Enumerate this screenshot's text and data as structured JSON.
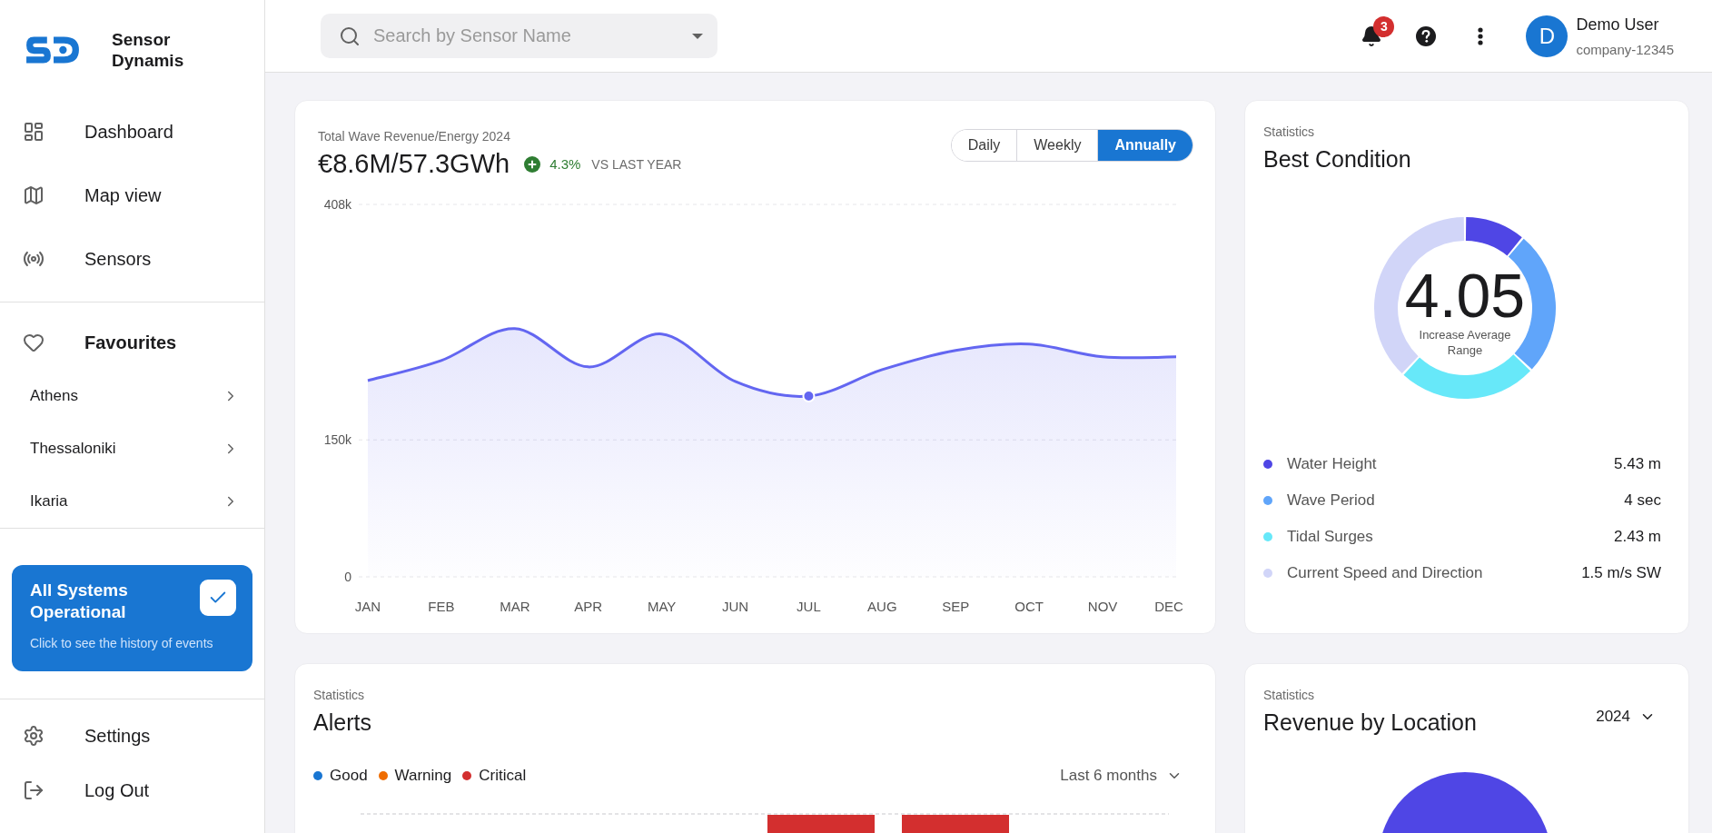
{
  "brand": {
    "name": "Sensor Dynamis"
  },
  "nav": [
    {
      "label": "Dashboard"
    },
    {
      "label": "Map view"
    },
    {
      "label": "Sensors"
    }
  ],
  "favourites": {
    "label": "Favourites",
    "items": [
      {
        "label": "Athens"
      },
      {
        "label": "Thessaloniki"
      },
      {
        "label": "Ikaria"
      }
    ]
  },
  "status_card": {
    "title": "All Systems Operational",
    "text": "Click to see the history of events",
    "checked": true
  },
  "footer_nav": [
    {
      "label": "Settings"
    },
    {
      "label": "Log Out"
    }
  ],
  "header": {
    "search": {
      "placeholder": "Search by Sensor Name"
    },
    "notifications": {
      "count": "3"
    },
    "user": {
      "initial": "D",
      "name": "Demo User",
      "company": "company-12345"
    }
  },
  "revenue_card": {
    "label": "Total Wave Revenue/Energy 2024",
    "value": "€8.6M/57.3GWh",
    "change": "4.3%",
    "change_caption": "VS LAST YEAR",
    "periods": [
      {
        "label": "Daily",
        "selected": false
      },
      {
        "label": "Weekly",
        "selected": false
      },
      {
        "label": "Annually",
        "selected": true
      }
    ],
    "chart_data": {
      "type": "area",
      "categories": [
        "JAN",
        "FEB",
        "MAR",
        "APR",
        "MAY",
        "JUN",
        "JUL",
        "AUG",
        "SEP",
        "OCT",
        "NOV",
        "DEC"
      ],
      "series": [
        {
          "color": "#6366f1",
          "values": [
            215000,
            237000,
            272000,
            230000,
            266000,
            214000,
            198000,
            227000,
            248000,
            255000,
            241000,
            241000
          ]
        }
      ],
      "ylim": [
        0,
        408000
      ],
      "yticks": [
        {
          "value": 0,
          "label": "0"
        },
        {
          "value": 150000,
          "label": "150k"
        },
        {
          "value": 408000,
          "label": "408k"
        }
      ],
      "annotations": [
        {
          "x": "JUL"
        }
      ]
    }
  },
  "best_condition": {
    "label": "Statistics",
    "title": "Best Condition",
    "value": "4.05",
    "caption": "Increase Average Range",
    "items": [
      {
        "name": "Water Height",
        "value": "5.43 m",
        "color": "#4f46e5"
      },
      {
        "name": "Wave Period",
        "value": "4 sec",
        "color": "#60a5fa"
      },
      {
        "name": "Tidal Surges",
        "value": "2.43 m",
        "color": "#67e8f9"
      },
      {
        "name": "Current Speed and Direction",
        "value": "1.5 m/s SW",
        "color": "#d1d5f8"
      }
    ]
  },
  "alerts": {
    "label": "Statistics",
    "title": "Alerts",
    "range": "Last 6 months",
    "legend": [
      {
        "name": "Good",
        "color": "#1976d2"
      },
      {
        "name": "Warning",
        "color": "#ef6c00"
      },
      {
        "name": "Critical",
        "color": "#d32f2f"
      }
    ]
  },
  "revenue_by_location": {
    "label": "Statistics",
    "title": "Revenue by Location",
    "year": "2024"
  }
}
